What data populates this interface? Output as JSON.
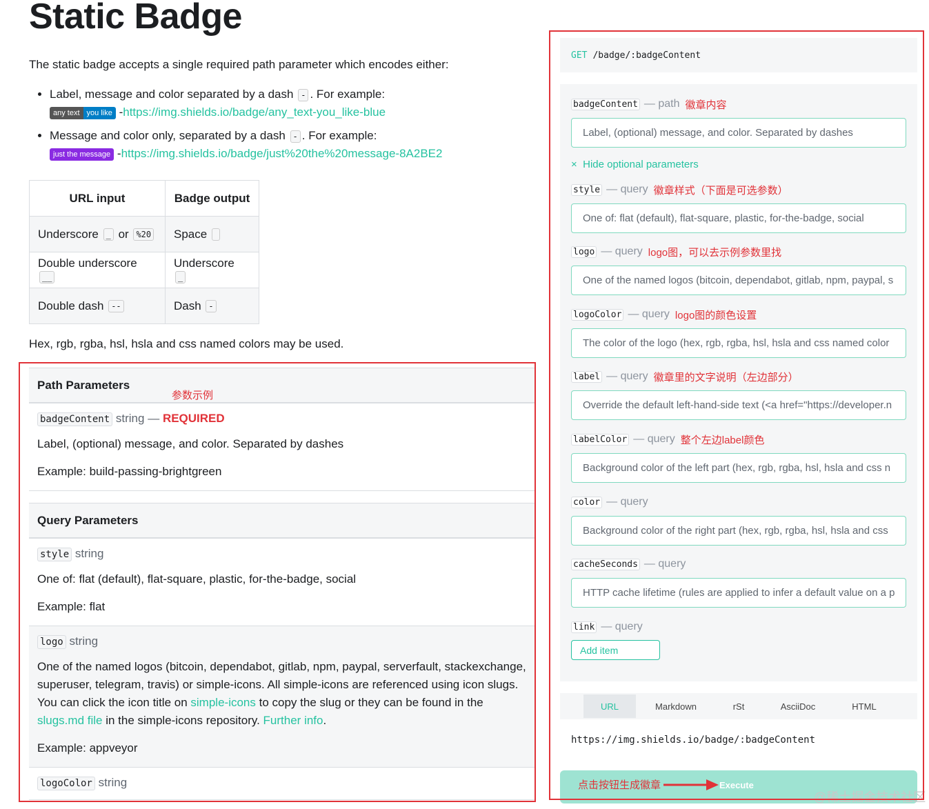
{
  "title": "Static Badge",
  "intro": "The static badge accepts a single required path parameter which encodes either:",
  "bullets": [
    {
      "text_before": "Label, message and color separated by a dash",
      "text_after": ". For example:",
      "dash": "-",
      "badge_left": "any text",
      "badge_right": "you like",
      "sep": "-",
      "link": "https://img.shields.io/badge/any_text-you_like-blue"
    },
    {
      "text_before": "Message and color only, separated by a dash",
      "text_after": ". For example:",
      "dash": "-",
      "badge_solo": "just the message",
      "sep": "-",
      "link": "https://img.shields.io/badge/just%20the%20message-8A2BE2"
    }
  ],
  "url_table": {
    "headers": [
      "URL input",
      "Badge output"
    ],
    "rows": [
      {
        "input": "Underscore",
        "input_code": "_",
        "or": "or",
        "input_code2": "%20",
        "output": "Space",
        "output_code": " "
      },
      {
        "input": "Double underscore",
        "input_code": "__",
        "output": "Underscore",
        "output_code": "_"
      },
      {
        "input": "Double dash",
        "input_code": "--",
        "output": "Dash",
        "output_code": "-"
      }
    ]
  },
  "colors_note": "Hex, rgb, rgba, hsl, hsla and css named colors may be used.",
  "path_params": {
    "heading": "Path Parameters",
    "annotation": "参数示例",
    "items": [
      {
        "name": "badgeContent",
        "type": "string",
        "dash": "—",
        "required": "REQUIRED",
        "desc": "Label, (optional) message, and color. Separated by dashes",
        "example": "Example: build-passing-brightgreen"
      }
    ]
  },
  "query_params": {
    "heading": "Query Parameters",
    "items": [
      {
        "name": "style",
        "type": "string",
        "desc": "One of: flat (default), flat-square, plastic, for-the-badge, social",
        "example": "Example: flat"
      },
      {
        "name": "logo",
        "type": "string",
        "desc1": "One of the named logos (bitcoin, dependabot, gitlab, npm, paypal, serverfault, stackexchange, superuser, telegram, travis) or simple-icons. All simple-icons are referenced using icon slugs. You can click the icon title on ",
        "link1": "simple-icons",
        "desc2": " to copy the slug or they can be found in the ",
        "link2": "slugs.md file",
        "desc3": " in the simple-icons repository. ",
        "link3": "Further info",
        "desc4": ".",
        "example": "Example: appveyor"
      },
      {
        "name": "logoColor",
        "type": "string"
      }
    ]
  },
  "endpoint": {
    "method": "GET",
    "path": "/badge/:badgeContent"
  },
  "form": {
    "hide_optional": "Hide optional parameters",
    "hide_icon": "×",
    "fields": [
      {
        "name": "badgeContent",
        "kind": "— path",
        "note": "徽章内容",
        "placeholder": "Label, (optional) message, and color. Separated by dashes"
      },
      {
        "name": "style",
        "kind": "— query",
        "note": "徽章样式（下面是可选参数）",
        "placeholder": "One of: flat (default), flat-square, plastic, for-the-badge, social"
      },
      {
        "name": "logo",
        "kind": "— query",
        "note": "logo图，可以去示例参数里找",
        "placeholder": "One of the named logos (bitcoin, dependabot, gitlab, npm, paypal, s"
      },
      {
        "name": "logoColor",
        "kind": "— query",
        "note": "logo图的颜色设置",
        "placeholder": "The color of the logo (hex, rgb, rgba, hsl, hsla and css named color"
      },
      {
        "name": "label",
        "kind": "— query",
        "note": "徽章里的文字说明（左边部分）",
        "placeholder": "Override the default left-hand-side text (<a href=\"https://developer.n"
      },
      {
        "name": "labelColor",
        "kind": "— query",
        "note": "整个左边label颜色",
        "placeholder": "Background color of the left part (hex, rgb, rgba, hsl, hsla and css n"
      },
      {
        "name": "color",
        "kind": "— query",
        "note": "",
        "placeholder": "Background color of the right part (hex, rgb, rgba, hsl, hsla and css"
      },
      {
        "name": "cacheSeconds",
        "kind": "— query",
        "note": "",
        "placeholder": "HTTP cache lifetime (rules are applied to infer a default value on a p"
      },
      {
        "name": "link",
        "kind": "— query",
        "note": ""
      }
    ],
    "add_item": "Add item"
  },
  "output_tabs": [
    "URL",
    "Markdown",
    "rSt",
    "AsciiDoc",
    "HTML"
  ],
  "output_url": "https://img.shields.io/badge/:badgeContent",
  "execute": {
    "label": "Execute",
    "note": "点击按钮生成徽章"
  },
  "watermark": "@稀土掘金技术社区",
  "colors": {
    "accent": "#25c2a0",
    "annotation_red": "#e13238",
    "badge_blue": "#007ec6",
    "badge_purple": "#8a2be2"
  }
}
